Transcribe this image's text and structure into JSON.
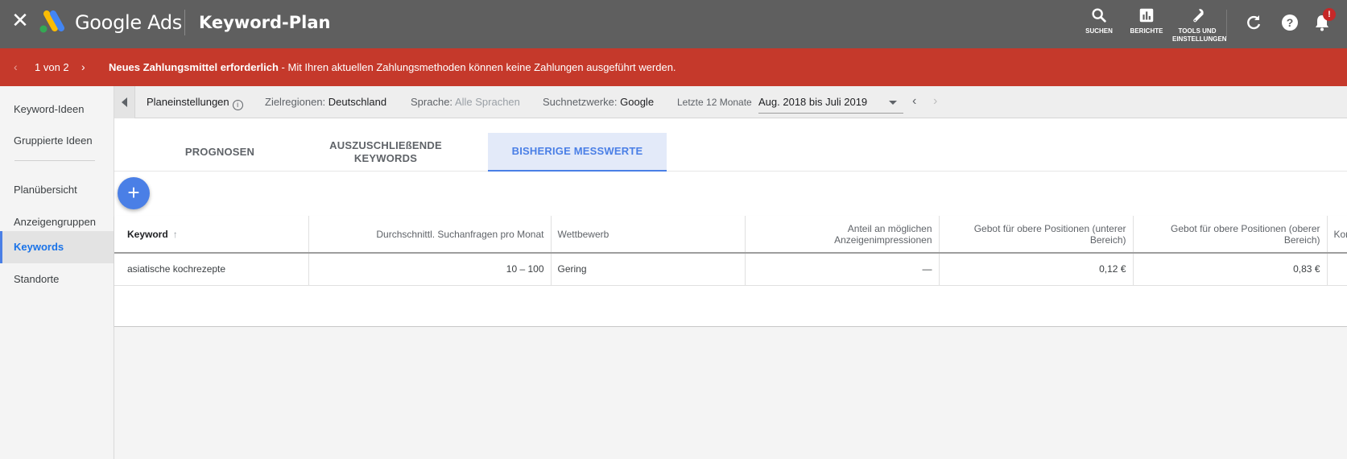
{
  "topbar": {
    "brand": "Google Ads",
    "title": "Keyword-Plan",
    "tools": [
      {
        "label": "SUCHEN",
        "icon": "search-icon"
      },
      {
        "label": "BERICHTE",
        "icon": "reports-icon"
      },
      {
        "label_line1": "TOOLS UND",
        "label_line2": "EINSTELLUNGEN",
        "icon": "wrench-icon"
      }
    ],
    "notification_badge": "!",
    "close_glyph": "✕"
  },
  "alert": {
    "counter": "1 von 2",
    "bold_text": "Neues Zahlungsmittel erforderlich",
    "text": " - Mit Ihren aktuellen Zahlungsmethoden können keine Zahlungen ausgeführt werden.",
    "prev_glyph": "‹",
    "next_glyph": "›"
  },
  "sidebar": {
    "items": [
      {
        "label": "Keyword-Ideen",
        "active": false
      },
      {
        "label": "Gruppierte Ideen",
        "active": false
      },
      {
        "label": "Planübersicht",
        "active": false
      },
      {
        "label": "Anzeigengruppen",
        "active": false
      },
      {
        "label": "Keywords",
        "active": true
      },
      {
        "label": "Standorte",
        "active": false
      }
    ]
  },
  "settings": {
    "plan_settings": "Planeinstellungen",
    "regions_label": "Zielregionen:",
    "regions_value": "Deutschland",
    "language_label": "Sprache:",
    "language_value": "Alle Sprachen",
    "networks_label": "Suchnetzwerke:",
    "networks_value": "Google",
    "period_label": "Letzte 12 Monate",
    "period_value": "Aug. 2018 bis Juli 2019",
    "prev_glyph": "‹",
    "next_glyph": "›"
  },
  "tabs": [
    {
      "label": "PROGNOSEN",
      "active": false
    },
    {
      "label_line1": "AUSZUSCHLIEßENDE",
      "label_line2": "KEYWORDS",
      "active": false
    },
    {
      "label": "BISHERIGE MESSWERTE",
      "active": true
    }
  ],
  "fab": {
    "glyph": "+"
  },
  "table": {
    "headers": {
      "keyword": "Keyword",
      "searches": "Durchschnittl. Suchanfragen pro Monat",
      "competition": "Wettbewerb",
      "impression_share": "Anteil an möglichen Anzeigenimpressionen",
      "bid_low": "Gebot für obere Positionen (unterer Bereich)",
      "bid_high": "Gebot für obere Positionen (oberer Bereich)",
      "cut": "Kon"
    },
    "rows": [
      {
        "keyword": "asiatische kochrezepte",
        "searches": "10 – 100",
        "competition": "Gering",
        "impression_share": "—",
        "bid_low": "0,12 €",
        "bid_high": "0,83 €",
        "cut": ""
      }
    ]
  },
  "colors": {
    "topbar": "#5f5f5f",
    "alert": "#c5392b",
    "accent": "#4a7fe6",
    "active_tab_bg": "#e3eaf9",
    "sidebar_bg": "#f4f4f4"
  }
}
